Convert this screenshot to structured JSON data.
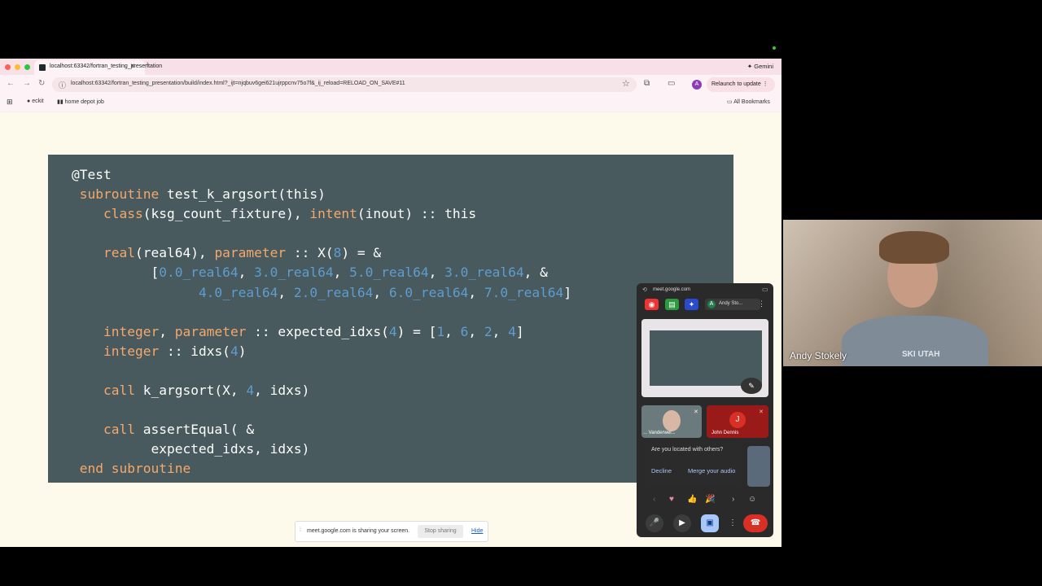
{
  "browser": {
    "tab_title": "localhost:63342/fortran_testing_presentation",
    "gemini_label": "Gemini",
    "url": "localhost:63342/fortran_testing_presentation/build/index.html?_ijt=njqbuv6gei621ujrppcnv75o7f&_ij_reload=RELOAD_ON_SAVE#11",
    "relaunch_label": "Relaunch to update",
    "avatar_letter": "A",
    "bookmarks": [
      "eckit",
      "home depot job"
    ],
    "all_bookmarks_label": "All Bookmarks"
  },
  "slide": {
    "code_lines": [
      "@Test",
      " subroutine test_k_argsort(this)",
      "    class(ksg_count_fixture), intent(inout) :: this",
      "",
      "    real(real64), parameter :: X(8) = &",
      "          [0.0_real64, 3.0_real64, 5.0_real64, 3.0_real64, &",
      "                4.0_real64, 2.0_real64, 6.0_real64, 7.0_real64]",
      "",
      "    integer, parameter :: expected_idxs(4) = [1, 6, 2, 4]",
      "    integer :: idxs(4)",
      "",
      "    call k_argsort(X, 4, idxs)",
      "",
      "    call assertEqual( &",
      "          expected_idxs, idxs)",
      " end subroutine"
    ],
    "colors": {
      "background": "#485a5e",
      "keyword": "#f4a86c",
      "number": "#5e9dcf",
      "text": "#fdfdfd"
    }
  },
  "sharebar": {
    "text": "meet.google.com is sharing your screen.",
    "stop_label": "Stop sharing",
    "hide_label": "Hide"
  },
  "meet": {
    "origin": "meet.google.com",
    "self_name": "Andy Sto...",
    "self_initial": "A",
    "participant1_name": "... Vanderwei...",
    "participant2_initial": "J",
    "participant2_name": "John Dennis",
    "prompt_question": "Are you located with others?",
    "decline_label": "Decline",
    "merge_label": "Merge your audio"
  },
  "webcam": {
    "name": "Andy Stokely",
    "shirt_text": "SKI UTAH"
  }
}
